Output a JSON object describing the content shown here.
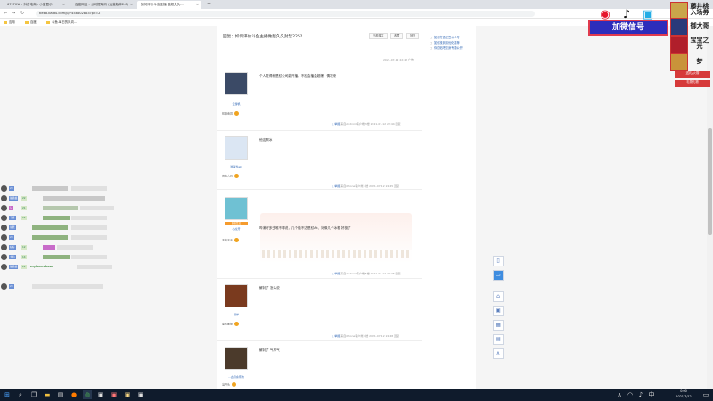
{
  "browser": {
    "tabs": [
      {
        "label": "672F0W - 抖音电商 - 小窗显示",
        "active": false
      },
      {
        "label": "百度网盘 - 公司提取码 (运营版本2.0)",
        "active": false
      },
      {
        "label": "如何评价斗鱼主播 做超久久...",
        "active": true
      }
    ],
    "new_tab": "+",
    "url": "tieba.baidu.com/p/7458602863?pn=2",
    "bookmarks": [
      "应用",
      "百度",
      "斗鱼-每日的风向..."
    ]
  },
  "thread": {
    "title": "回复：如何评价斗鱼主播做超久久封禁225?",
    "buttons": [
      "只看楼主",
      "收藏",
      "回复"
    ],
    "side_links": [
      "如何打造爱豆公众号",
      "如何找到最优化推荐",
      "你的贴吧变身专题公开"
    ],
    "top_meta": "2021-07-12 22:42  广告"
  },
  "posts": [
    {
      "user": "云游帆",
      "level": "初级会员",
      "text": "个人觉得就是怼公司能开播、不怼会播会超爆、情况来",
      "foot_links": "△ 举报",
      "foot": "来自Android客户端  3楼  2021-07-12 22:44  回复"
    },
    {
      "user": "暴躁当aki",
      "level": "贤达大将",
      "text": "他这啊冰",
      "foot_links": "△ 举报",
      "foot": "来自iPhone客户端  4楼  2021-07-12 22:45  回复"
    },
    {
      "user": "小虎牙",
      "level": "玉笛王子",
      "vip": "超级会员",
      "text": "哔浦好多虫唯不哪说，几个触不达是怼Ak、好像几个冰棍  好极了",
      "foot_links": "△ 举报",
      "foot": "来自Android客户端  5楼  2021-07-12 22:46  回复"
    },
    {
      "user": "隔岸",
      "level": "全民星探",
      "text": "解封了 怎么说",
      "foot_links": "△ 举报",
      "foot": "来自iPhone客户端  6楼  2021-07-12 22:48  回复"
    },
    {
      "user": "...古月余奈的",
      "level": "当开头",
      "text": "解封了 气尽气",
      "foot_links": "",
      "foot": ""
    }
  ],
  "float_bar": [
    "phone-icon",
    "message-icon",
    "rocket-icon",
    "gift-icon",
    "calendar-icon",
    "feedback-icon",
    "top-icon"
  ],
  "chat": [
    {
      "level": "20",
      "num": "",
      "name": "",
      "msg": ""
    },
    {
      "level": "猫猫酱",
      "num": "22",
      "name": "",
      "msg": ""
    },
    {
      "level": "Ｕ",
      "num": "21",
      "name": "",
      "msg": ""
    },
    {
      "level": "千喜",
      "num": "12",
      "name": "",
      "msg": ""
    },
    {
      "level": "星辰",
      "num": "",
      "name": "",
      "msg": ""
    },
    {
      "level": "20",
      "num": "",
      "name": "",
      "msg": ""
    },
    {
      "level": "好好",
      "num": "12",
      "name": "",
      "msg": ""
    },
    {
      "level": "大仙",
      "num": "14",
      "name": "",
      "msg": ""
    },
    {
      "level": "猫猫酱",
      "num": "22",
      "name": "myloveshow",
      "msg": ""
    },
    {
      "level": "20",
      "num": "",
      "name": "",
      "msg": ""
    }
  ],
  "overlay": {
    "banner": "加微信号",
    "gifts": [
      {
        "label": "藤井桃入场券"
      },
      {
        "label": "御大哥"
      },
      {
        "label": "宝宝之光"
      },
      {
        "label": "梦"
      }
    ],
    "strips": [
      "送礼/火箭",
      "礼物礼物"
    ]
  },
  "taskbar": {
    "time": "0:00",
    "date": "2021/7/12"
  },
  "colors": {
    "accent": "#2d64b3",
    "banner": "#2d2dbb",
    "taskbar": "#0f1b2c"
  }
}
